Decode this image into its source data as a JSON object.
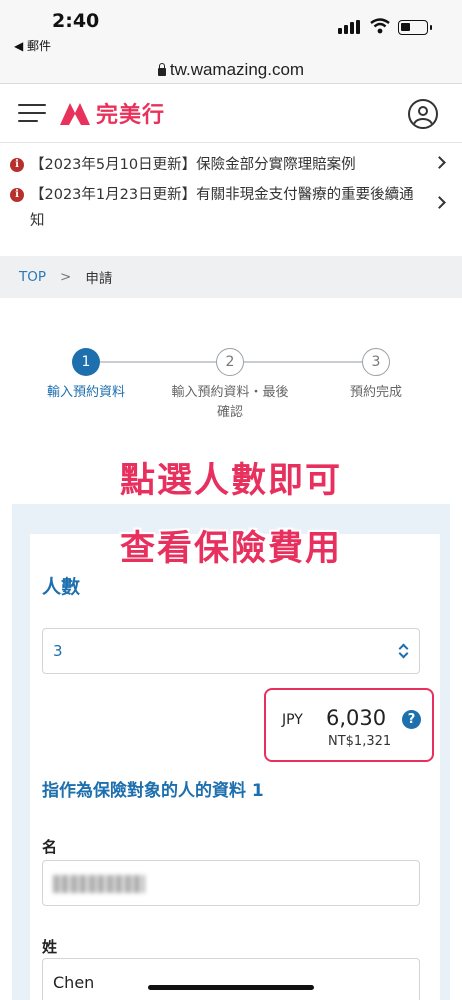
{
  "status_bar": {
    "time": "2:40",
    "back_app": "◀ 郵件"
  },
  "browser": {
    "url": "tw.wamazing.com"
  },
  "header": {
    "logo_text": "完美行",
    "brand_color": "#e8315b"
  },
  "notices": [
    {
      "text": "【2023年5月10日更新】保險金部分實際理賠案例"
    },
    {
      "text": "【2023年1月23日更新】有關非現金支付醫療的重要後續通知"
    }
  ],
  "breadcrumb": {
    "top": "TOP",
    "separator": ">",
    "current": "申請"
  },
  "stepper": {
    "steps": [
      {
        "number": "1",
        "label": "輸入預約資料",
        "active": true
      },
      {
        "number": "2",
        "label": "輸入預約資料・最後確認",
        "active": false
      },
      {
        "number": "3",
        "label": "預約完成",
        "active": false
      }
    ]
  },
  "overlay": {
    "line1": "點選人數即可",
    "line2": "查看保險費用",
    "color": "#e8305e"
  },
  "form": {
    "people_title": "人數",
    "people_value": "3",
    "price": {
      "currency": "JPY",
      "amount": "6,030",
      "help": "?",
      "twd": "NT$1,321"
    },
    "insured_title": "指作為保險對象的人的資料 1",
    "first_name_label": "名",
    "last_name_label": "姓",
    "last_name_value": "Chen"
  },
  "accent_color": "#1d6fae"
}
